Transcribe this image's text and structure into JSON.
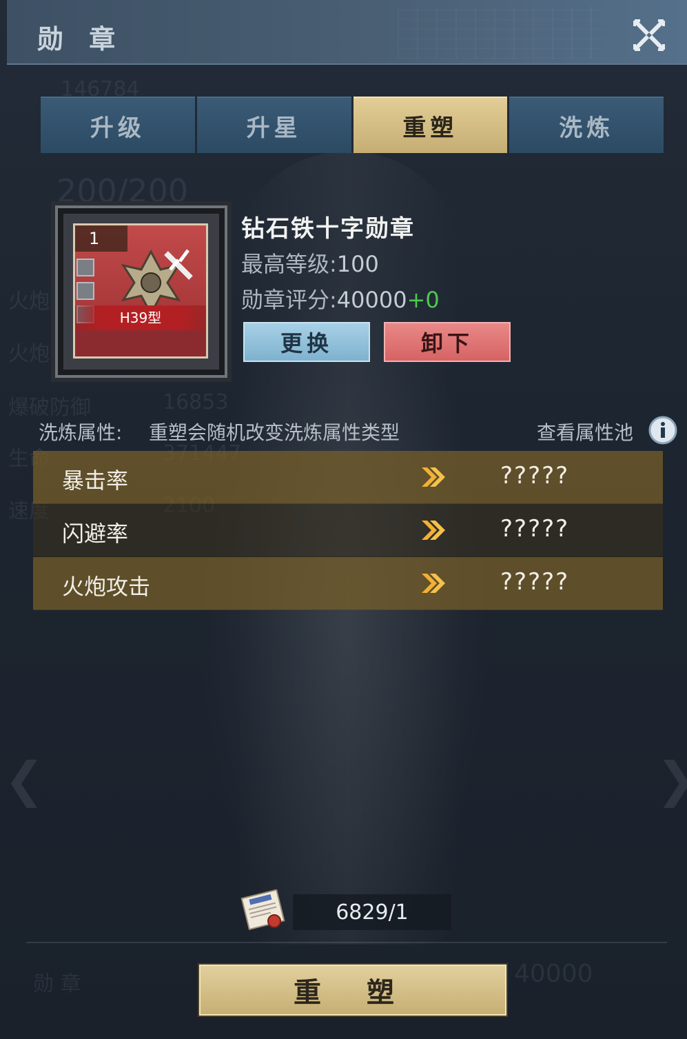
{
  "window": {
    "title": "勋 章"
  },
  "tabs": [
    {
      "label": "升级",
      "active": false
    },
    {
      "label": "升星",
      "active": false
    },
    {
      "label": "重塑",
      "active": true
    },
    {
      "label": "洗炼",
      "active": false
    }
  ],
  "medal": {
    "level_badge": "1",
    "type_label": "H39型",
    "name": "钻石铁十字勋章",
    "max_level_label": "最高等级:",
    "max_level_value": "100",
    "score_label": "勋章评分:",
    "score_value": "40000",
    "score_bonus": "+0",
    "replace_label": "更换",
    "remove_label": "卸下"
  },
  "refine": {
    "label": "洗炼属性:",
    "description": "重塑会随机改变洗炼属性类型",
    "pool_link": "查看属性池",
    "rows": [
      {
        "name": "暴击率",
        "value": "?????"
      },
      {
        "name": "闪避率",
        "value": "?????"
      },
      {
        "name": "火炮攻击",
        "value": "?????"
      }
    ]
  },
  "cost": {
    "text": "6829/1"
  },
  "action": {
    "label": "重 塑"
  },
  "background_ghost": {
    "number_top": "146784",
    "level": "200/200",
    "stat1": "火炮",
    "stat2": "火炮",
    "stat3_name": "爆破防御",
    "stat3_val": "16853",
    "stat4_name": "生命",
    "stat4_val": "371447",
    "stat5_name": "速度",
    "stat5_val": "2100",
    "bottom_left": "勋 章",
    "bottom_right": "40000"
  },
  "colors": {
    "accent_gold": "#c5ae74",
    "tab_blue": "#2c4a63",
    "positive": "#4ec94e"
  }
}
